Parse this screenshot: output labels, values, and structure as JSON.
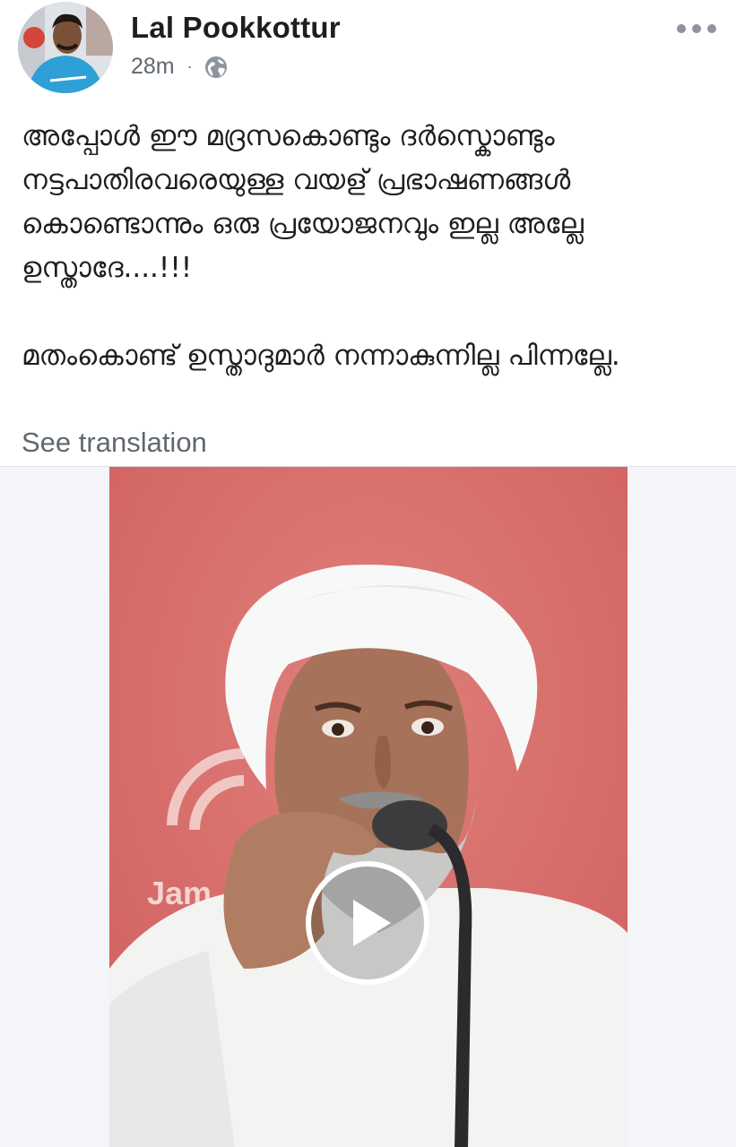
{
  "post": {
    "author": "Lal Pookkottur",
    "time": "28m",
    "separator": "·",
    "privacy_icon": "globe-icon",
    "more_icon": "more-horizontal-icon",
    "text_paragraphs": [
      "അപ്പോൾ ഈ മദ്രസകൊണ്ടും ദർസ്കൊണ്ടും നട്ടപാതിരവരെയുള്ള വയള് പ്രഭാഷണങ്ങൾ കൊണ്ടൊന്നും ഒരു പ്രയോജനവും ഇല്ല അല്ലേ ഉസ്താദേ....!!!",
      "മതംകൊണ്ട് ഉസ്താദുമാർ  നന്നാകുന്നില്ല പിന്നല്ലേ."
    ],
    "see_translation": "See translation"
  },
  "video": {
    "thumbnail_icon": "video-thumbnail",
    "play_icon": "play-icon",
    "logo_text": "Jam",
    "background_color": "#d96b69"
  },
  "colors": {
    "text_primary": "#1c1e21",
    "text_secondary": "#606770",
    "media_bg": "#f3f5f8"
  }
}
